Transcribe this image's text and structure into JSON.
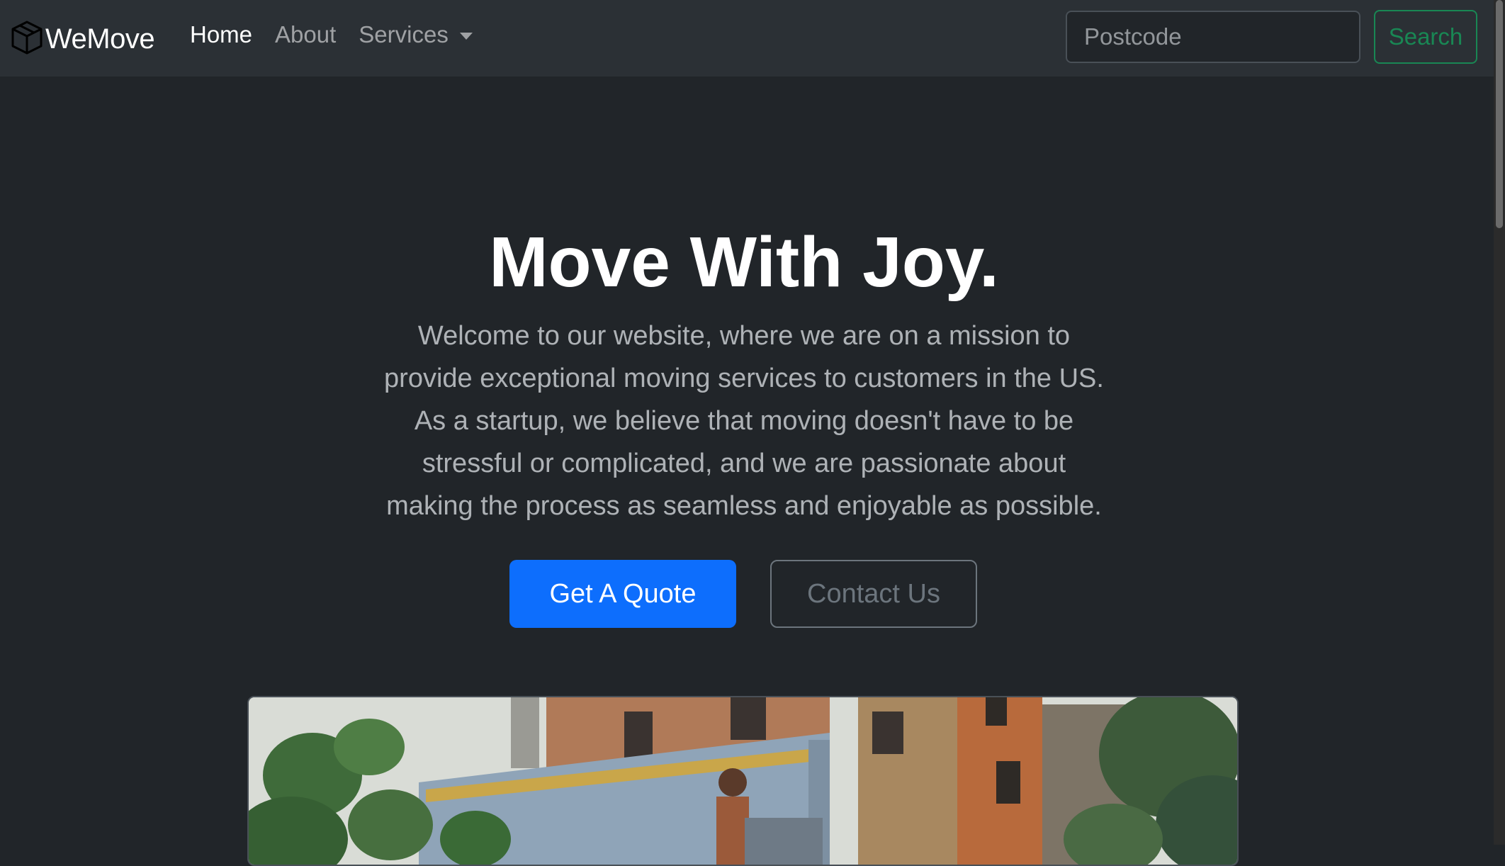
{
  "brand": {
    "name": "WeMove",
    "icon": "box-icon"
  },
  "nav": {
    "items": [
      {
        "label": "Home",
        "active": true
      },
      {
        "label": "About",
        "active": false
      },
      {
        "label": "Services",
        "active": false,
        "dropdown": true
      }
    ]
  },
  "search": {
    "placeholder": "Postcode",
    "value": "",
    "button_label": "Search"
  },
  "hero": {
    "title": "Move With Joy.",
    "lead": "Welcome to our website, where we are on a mission to provide exceptional moving services to customers in the US. As a startup, we believe that moving doesn't have to be stressful or complicated, and we are passionate about making the process as seamless and enjoyable as possible.",
    "primary_button": "Get A Quote",
    "secondary_button": "Contact Us",
    "image": "moving-truck-photo"
  },
  "colors": {
    "background": "#212529",
    "navbar": "#2b3035",
    "primary": "#0d6efd",
    "success": "#198754",
    "secondary": "#6c757d"
  }
}
